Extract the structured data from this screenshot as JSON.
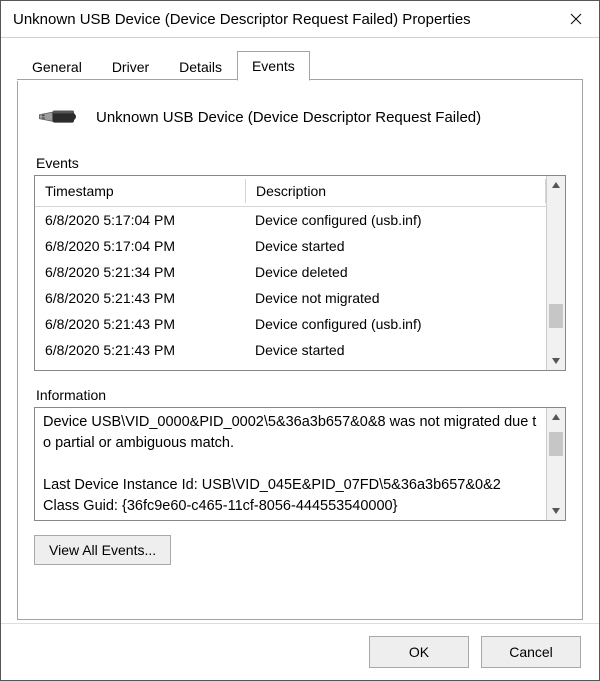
{
  "window": {
    "title": "Unknown USB Device (Device Descriptor Request Failed) Properties"
  },
  "tabs": [
    {
      "label": "General"
    },
    {
      "label": "Driver"
    },
    {
      "label": "Details"
    },
    {
      "label": "Events"
    }
  ],
  "active_tab_index": 3,
  "device": {
    "name": "Unknown USB Device (Device Descriptor Request Failed)"
  },
  "events_section": {
    "label": "Events",
    "columns": {
      "timestamp": "Timestamp",
      "description": "Description"
    },
    "rows": [
      {
        "ts": "6/8/2020 5:17:04 PM",
        "desc": "Device configured (usb.inf)"
      },
      {
        "ts": "6/8/2020 5:17:04 PM",
        "desc": "Device started"
      },
      {
        "ts": "6/8/2020 5:21:34 PM",
        "desc": "Device deleted"
      },
      {
        "ts": "6/8/2020 5:21:43 PM",
        "desc": "Device not migrated"
      },
      {
        "ts": "6/8/2020 5:21:43 PM",
        "desc": "Device configured (usb.inf)"
      },
      {
        "ts": "6/8/2020 5:21:43 PM",
        "desc": "Device started"
      }
    ]
  },
  "information_section": {
    "label": "Information",
    "text": "Device USB\\VID_0000&PID_0002\\5&36a3b657&0&8 was not migrated due to partial or ambiguous match.\n\nLast Device Instance Id: USB\\VID_045E&PID_07FD\\5&36a3b657&0&2\nClass Guid: {36fc9e60-c465-11cf-8056-444553540000}"
  },
  "buttons": {
    "view_all": "View All Events...",
    "ok": "OK",
    "cancel": "Cancel"
  }
}
